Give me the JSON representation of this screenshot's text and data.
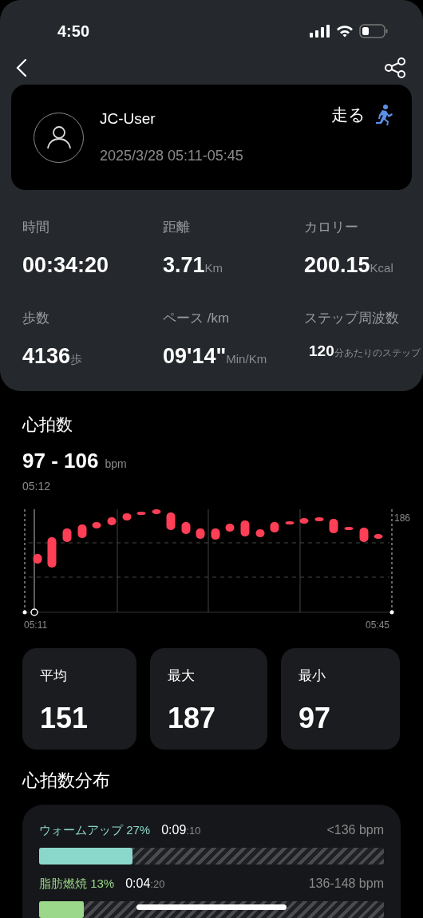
{
  "status_bar": {
    "time": "4:50"
  },
  "header": {
    "user": "JC-User",
    "datetime": "2025/3/28 05:11-05:45",
    "activity": "走る"
  },
  "metrics": [
    {
      "label": "時間",
      "value": "00:34:20"
    },
    {
      "label": "距離",
      "value": "3.71",
      "unit": "Km"
    },
    {
      "label": "カロリー",
      "value": "200.15",
      "unit": "Kcal"
    },
    {
      "label": "歩数",
      "value": "4136",
      "unit": "歩"
    },
    {
      "label": "ペース /km",
      "value": "09'14\"",
      "unit": "Min/Km"
    },
    {
      "label": "ステップ周波数",
      "value": "120",
      "unit": "分あたりのステップ",
      "kind": "small"
    }
  ],
  "heart_rate": {
    "title": "心拍数",
    "range": "97 - 106",
    "unit": "bpm",
    "time": "05:12",
    "y_label": "186",
    "x_start": "05:11",
    "x_end": "05:45"
  },
  "stats": [
    {
      "label": "平均",
      "value": "151"
    },
    {
      "label": "最大",
      "value": "187"
    },
    {
      "label": "最小",
      "value": "97"
    }
  ],
  "distribution": {
    "title": "心拍数分布",
    "zones": [
      {
        "name": "ウォームアップ 27%",
        "time": "0:09",
        "seconds": ":10",
        "range": "<136 bpm",
        "level": 0.27,
        "color": "#8ad8cc"
      },
      {
        "name": "脂肪燃焼 13%",
        "time": "0:04",
        "seconds": ":20",
        "range": "136-148 bpm",
        "level": 0.13,
        "color": "#9bd88a"
      }
    ]
  }
}
